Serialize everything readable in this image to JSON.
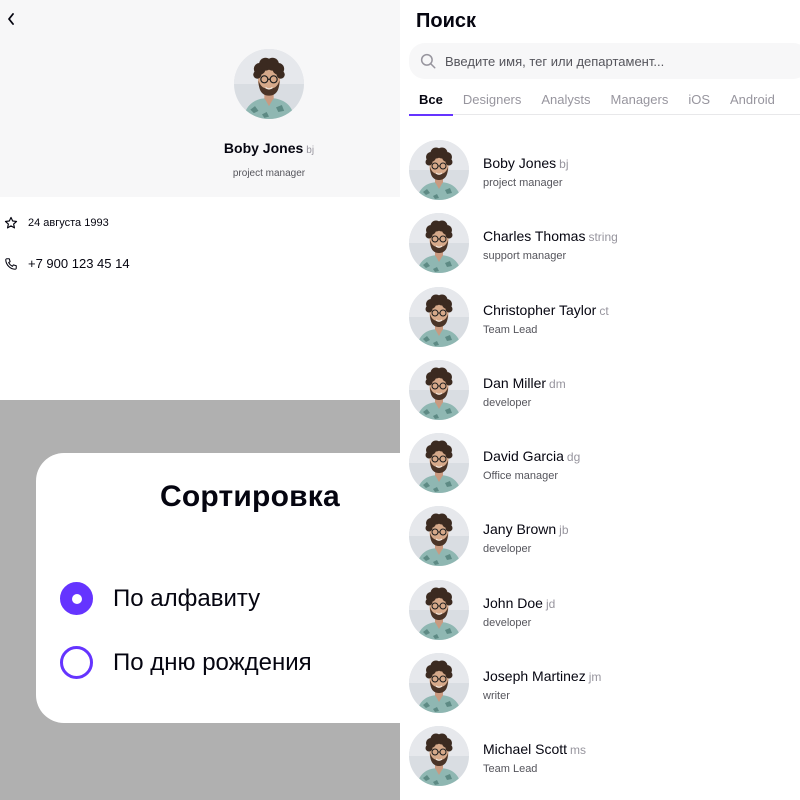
{
  "profile": {
    "name": "Boby Jones",
    "tag": "bj",
    "role": "project manager",
    "birthday": "24 августа 1993",
    "phone": "+7 900 123 45 14"
  },
  "sort": {
    "title": "Сортировка",
    "options": [
      {
        "label": "По алфавиту",
        "selected": true
      },
      {
        "label": "По дню рождения",
        "selected": false
      }
    ]
  },
  "search": {
    "title": "Поиск",
    "placeholder": "Введите имя, тег или департамент...",
    "tabs": [
      "Все",
      "Designers",
      "Analysts",
      "Managers",
      "iOS",
      "Android"
    ],
    "active_tab": "Все",
    "people": [
      {
        "name": "Boby Jones",
        "tag": "bj",
        "role": "project manager"
      },
      {
        "name": "Charles Thomas",
        "tag": "string",
        "role": "support manager"
      },
      {
        "name": "Christopher Taylor",
        "tag": "ct",
        "role": "Team Lead"
      },
      {
        "name": "Dan Miller",
        "tag": "dm",
        "role": "developer"
      },
      {
        "name": "David Garcia",
        "tag": "dg",
        "role": "Office manager"
      },
      {
        "name": "Jany Brown",
        "tag": "jb",
        "role": "developer"
      },
      {
        "name": "John Doe",
        "tag": "jd",
        "role": "developer"
      },
      {
        "name": "Joseph Martinez",
        "tag": "jm",
        "role": "writer"
      },
      {
        "name": "Michael Scott",
        "tag": "ms",
        "role": "Team Lead"
      }
    ]
  },
  "colors": {
    "accent": "#6534ff",
    "text_primary": "#050510",
    "text_secondary": "#55555c",
    "text_tertiary": "#97959e",
    "surface": "#f7f7f8",
    "overlay": "#b0b0b0"
  },
  "icons": {
    "back": "chevron-left-icon",
    "birthday": "star-icon",
    "phone": "phone-icon",
    "search": "search-icon",
    "avatar": "avatar-photo"
  }
}
